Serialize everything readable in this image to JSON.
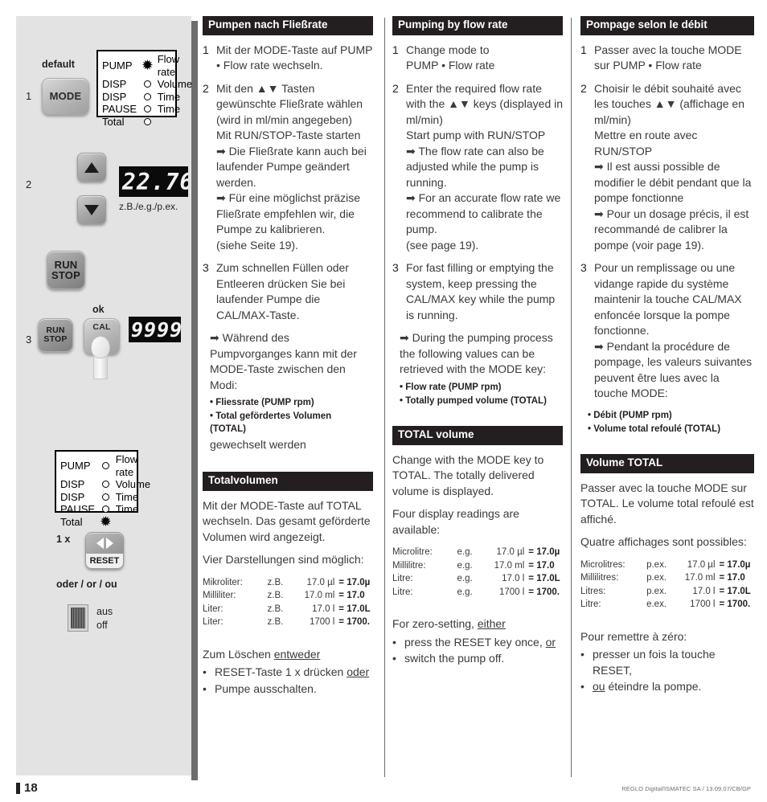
{
  "panel": {
    "step1_num": "1",
    "default_label": "default",
    "mode_key": "MODE",
    "mode_status": {
      "rows": [
        {
          "left": "PUMP",
          "led": "on",
          "right": "Flow rate"
        },
        {
          "left": "DISP",
          "led": "off",
          "right": "Volume"
        },
        {
          "left": "DISP",
          "led": "off",
          "right": "Time"
        },
        {
          "left": "PAUSE",
          "led": "off",
          "right": "Time"
        },
        {
          "left": "Total",
          "led": "off",
          "right": ""
        }
      ]
    },
    "step2_num": "2",
    "up_arrow": "▲",
    "down_arrow": "▼",
    "display_flow": "22.76",
    "display_flow_caption": "z.B./e.g./p.ex.",
    "run_key_line1": "RUN",
    "run_key_line2": "STOP",
    "step3_num": "3",
    "run_key2_line1": "RUN",
    "run_key2_line2": "STOP",
    "ok_label": "ok",
    "cal_key": "CAL",
    "display_total": "9999",
    "total_status": {
      "rows": [
        {
          "left": "PUMP",
          "led": "off",
          "right": "Flow rate"
        },
        {
          "left": "DISP",
          "led": "off",
          "right": "Volume"
        },
        {
          "left": "DISP",
          "led": "off",
          "right": "Time"
        },
        {
          "left": "PAUSE",
          "led": "off",
          "right": "Time"
        },
        {
          "left": "Total",
          "led": "on",
          "right": ""
        }
      ]
    },
    "once_label": "1 x",
    "reset_key": "RESET",
    "or_label": "oder / or / ou",
    "off_label_de": "aus",
    "off_label_en": "off"
  },
  "de": {
    "section1_title": "Pumpen nach Fließrate",
    "s1_items": [
      {
        "num": "1",
        "text": "Mit der MODE-Taste auf PUMP • Flow rate wechseln."
      },
      {
        "num": "2",
        "text": "Mit den ▲▼ Tasten gewünschte Fließrate wählen\n(wird in ml/min angegeben)\nMit RUN/STOP-Taste starten\n➡ Die Fließrate kann auch bei laufender Pumpe geändert werden.\n➡ Für eine möglichst präzise Fließrate empfehlen wir, die Pumpe zu kalibrieren.\n(siehe Seite 19)."
      },
      {
        "num": "3",
        "text": "Zum schnellen Füllen oder Entleeren drücken Sie bei laufender Pumpe die CAL/MAX-Taste."
      }
    ],
    "s1_note_intro": "➡ Während des Pumpvorganges kann mit der MODE-Taste zwischen den Modi:",
    "s1_bullets": [
      "• Fliessrate (PUMP rpm)",
      "• Total gefördertes Volumen\n   (TOTAL)"
    ],
    "s1_note_outro": "gewechselt werden",
    "section2_title": "Totalvolumen",
    "s2_para1": "Mit der MODE-Taste auf TOTAL wechseln. Das gesamt geförderte Volumen wird angezeigt.",
    "s2_para2": "Vier Darstellungen sind möglich:",
    "s2_table": [
      {
        "unit": "Mikroliter:",
        "eg": "z.B.",
        "value": "17.0 µl",
        "shown": "= 17.0µ"
      },
      {
        "unit": "Milliliter:",
        "eg": "z.B.",
        "value": "17.0 ml",
        "shown": "= 17.0"
      },
      {
        "unit": "Liter:",
        "eg": "z.B.",
        "value": "17.0 l",
        "shown": "= 17.0L"
      },
      {
        "unit": "Liter:",
        "eg": "z.B.",
        "value": "1700 l",
        "shown": "= 1700."
      }
    ],
    "s2_reset_intro_a": "Zum Löschen ",
    "s2_reset_intro_b": "entweder",
    "s2_bullets": [
      {
        "bullet": "•",
        "a": "RESET-Taste 1 x drücken ",
        "b": "oder"
      },
      {
        "bullet": "•",
        "a": "Pumpe ausschalten.",
        "b": ""
      }
    ]
  },
  "en": {
    "section1_title": "Pumping by flow rate",
    "s1_items": [
      {
        "num": "1",
        "text": "Change mode to\nPUMP • Flow rate"
      },
      {
        "num": "2",
        "text": "Enter the required flow rate with the ▲▼ keys (displayed in ml/min)\nStart pump with RUN/STOP\n➡ The flow rate can also be adjusted while the pump is running.\n➡ For an accurate flow rate we recommend to calibrate the pump.\n(see page 19)."
      },
      {
        "num": "3",
        "text": "For fast filling or emptying the system, keep pressing the CAL/MAX key while the pump is running."
      }
    ],
    "s1_note_intro": "➡ During the pumping process the following values can be retrieved with the MODE key:",
    "s1_bullets": [
      "• Flow rate (PUMP rpm)",
      "• Totally pumped volume (TOTAL)"
    ],
    "s1_note_outro": "",
    "section2_title": "TOTAL volume",
    "s2_para1": "Change with the MODE key to TOTAL. The totally delivered volume is displayed.",
    "s2_para2": "Four display readings are available:",
    "s2_table": [
      {
        "unit": "Microlitre:",
        "eg": "e.g.",
        "value": "17.0 µl",
        "shown": "= 17.0µ"
      },
      {
        "unit": "Millilitre:",
        "eg": "e.g.",
        "value": "17.0 ml",
        "shown": "= 17.0"
      },
      {
        "unit": "Litre:",
        "eg": "e.g.",
        "value": "17.0 l",
        "shown": "= 17.0L"
      },
      {
        "unit": "Litre:",
        "eg": "e.g.",
        "value": "1700 l",
        "shown": "= 1700."
      }
    ],
    "s2_reset_intro_a": "For zero-setting, ",
    "s2_reset_intro_b": "either",
    "s2_bullets": [
      {
        "bullet": "•",
        "a": "press the RESET key once, ",
        "b": "or"
      },
      {
        "bullet": "•",
        "a": "switch the pump off.",
        "b": ""
      }
    ]
  },
  "fr": {
    "section1_title": "Pompage selon le débit",
    "s1_items": [
      {
        "num": "1",
        "text": "Passer avec la touche MODE sur PUMP • Flow rate"
      },
      {
        "num": "2",
        "text": "Choisir le débit souhaité avec les touches ▲▼ (affichage en ml/min)\nMettre en route avec RUN/STOP\n➡ Il est aussi possible de modifier le débit pendant que la pompe fonctionne\n➡ Pour un dosage précis, il est recommandé de calibrer la pompe (voir page 19)."
      },
      {
        "num": "3",
        "text": "Pour un remplissage ou une vidange rapide du système maintenir la touche CAL/MAX enfoncée lorsque la pompe fonctionne.\n➡ Pendant la procédure de pompage, les valeurs suivantes peuvent être lues avec la touche MODE:"
      }
    ],
    "s1_note_intro": "",
    "s1_bullets": [
      "• Débit (PUMP rpm)",
      "• Volume total  refoulé (TOTAL)"
    ],
    "s1_note_outro": "",
    "section2_title": "Volume TOTAL",
    "s2_para1": "Passer avec la touche MODE sur TOTAL. Le volume total refoulé est affiché.",
    "s2_para2": "Quatre affichages sont possibles:",
    "s2_table": [
      {
        "unit": "Microlitres:",
        "eg": "p.ex.",
        "value": "17.0 µl",
        "shown": "= 17.0µ"
      },
      {
        "unit": "Millilitres:",
        "eg": "p.ex.",
        "value": "17.0 ml",
        "shown": "= 17.0"
      },
      {
        "unit": "Litres:",
        "eg": "p.ex.",
        "value": "17.0 l",
        "shown": "= 17.0L"
      },
      {
        "unit": "Litre:",
        "eg": "e.ex.",
        "value": "1700 l",
        "shown": "= 1700."
      }
    ],
    "s2_reset_intro_a": "Pour remettre à zéro:",
    "s2_reset_intro_b": "",
    "s2_bullets": [
      {
        "bullet": "•",
        "a": "presser un fois la touche RESET,",
        "b": ""
      },
      {
        "bullet": "•",
        "a": " éteindre la pompe.",
        "b": "ou"
      }
    ]
  },
  "footer": {
    "page_number": "18",
    "imprint_a": "REGLO ",
    "imprint_b": "Digital",
    "imprint_c": "/ISMATEC SA / 13.09.07/CB/GP"
  },
  "colors": {
    "header_bar": "#231f20",
    "panel_bg": "#e3e3e3",
    "panel_shadow": "#6d6d6d",
    "body_text": "#3a3a3a",
    "led_display_bg": "#0b0b0b"
  }
}
